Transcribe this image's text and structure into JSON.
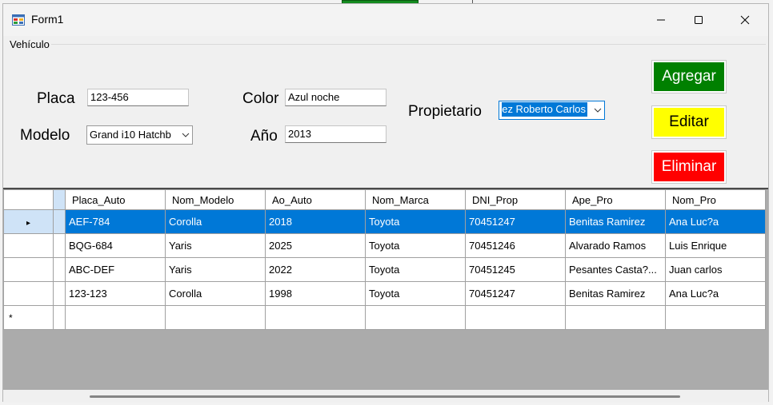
{
  "window": {
    "title": "Form1"
  },
  "groupbox": {
    "label": "Vehículo"
  },
  "form": {
    "placa_label": "Placa",
    "placa_value": "123-456",
    "modelo_label": "Modelo",
    "modelo_value": "Grand i10 Hatchb",
    "color_label": "Color",
    "color_value": "Azul noche",
    "anio_label": "Año",
    "anio_value": "2013",
    "propietario_label": "Propietario",
    "propietario_value": "ez Roberto Carlos"
  },
  "buttons": {
    "agregar": "Agregar",
    "editar": "Editar",
    "eliminar": "Eliminar"
  },
  "colors": {
    "agregar_bg": "#008000",
    "editar_bg": "#ffff00",
    "eliminar_bg": "#ff0000",
    "selection": "#0078d7"
  },
  "grid": {
    "columns": [
      "Placa_Auto",
      "Nom_Modelo",
      "Ao_Auto",
      "Nom_Marca",
      "DNI_Prop",
      "Ape_Pro",
      "Nom_Pro"
    ],
    "rows": [
      [
        "AEF-784",
        "Corolla",
        "2018",
        "Toyota",
        "70451247",
        "Benitas Ramirez",
        "Ana Luc?a"
      ],
      [
        "BQG-684",
        "Yaris",
        "2025",
        "Toyota",
        "70451246",
        "Alvarado Ramos",
        "Luis Enrique"
      ],
      [
        "ABC-DEF",
        "Yaris",
        "2022",
        "Toyota",
        "70451245",
        "Pesantes Casta?...",
        "Juan carlos"
      ],
      [
        "123-123",
        "Corolla",
        "1998",
        "Toyota",
        "70451247",
        "Benitas Ramirez",
        "Ana Luc?a"
      ]
    ],
    "selected_row": 0,
    "current_row_glyph": "▸",
    "new_row_glyph": "*"
  },
  "icons": {
    "app": "app-form-icon",
    "minimize": "minimize-icon",
    "maximize": "maximize-icon",
    "close": "close-icon"
  }
}
